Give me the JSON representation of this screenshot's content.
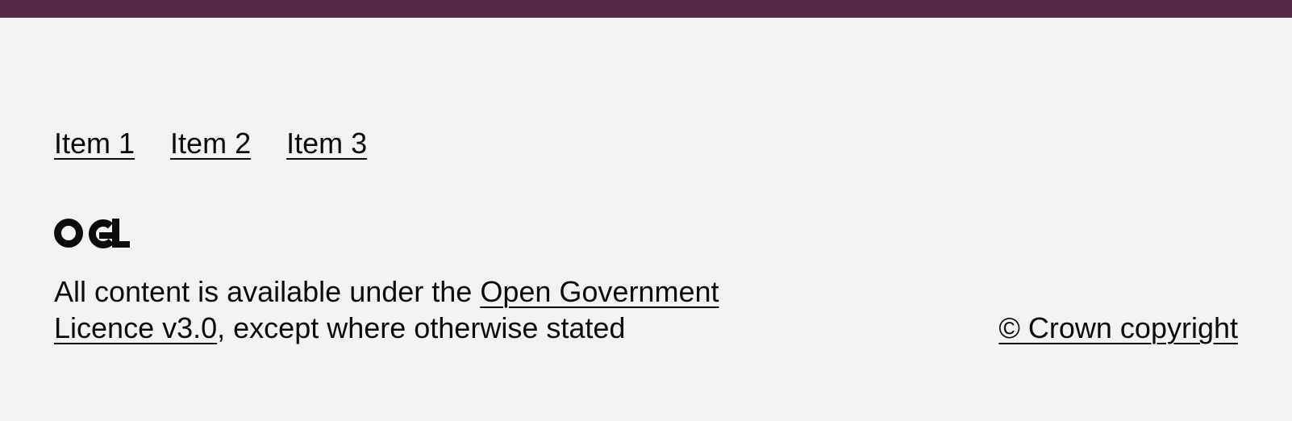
{
  "colors": {
    "top_bar": "#532a45",
    "background": "#f3f2f1",
    "text": "#0b0c0c"
  },
  "footer": {
    "links": [
      {
        "label": "Item 1"
      },
      {
        "label": "Item 2"
      },
      {
        "label": "Item 3"
      }
    ],
    "logo": {
      "icon": "ogl-logo-icon",
      "text": "OGL"
    },
    "licence": {
      "prefix": "All content is available under the ",
      "link_text": "Open Government Licence v3.0",
      "suffix": ", except where otherwise stated"
    },
    "copyright": "© Crown copyright"
  }
}
